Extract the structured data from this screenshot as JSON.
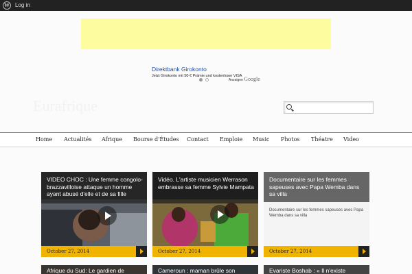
{
  "adminbar": {
    "login_label": "Log in"
  },
  "ad": {
    "title": "Direktbank Girokonto",
    "text": "Jetzt Girokonto mit 50 € Prämie und kostenloser VISA",
    "brand_prefix": "Anzeigen",
    "brand_name": "Google"
  },
  "site": {
    "title": "Eurafrique"
  },
  "search": {
    "value": ""
  },
  "nav": [
    "Home",
    "Actualités",
    "Afrique",
    "Bourse d'Études",
    "Contact",
    "Emploie",
    "Music",
    "Photos",
    "Théatre",
    "Video"
  ],
  "cards": [
    {
      "title": "VIDEO CHOC : Une femme congolo-brazzavilloise attaque un homme ayant abusé d'elle et de sa fille",
      "date": "October 27, 2014"
    },
    {
      "title": "Vidéo. L'artiste musicien Werrason embrasse sa femme Sylvie Mampata",
      "date": "October 27, 2014"
    },
    {
      "title": "Documentaire sur les femmes sapeuses avec Papa Wemba dans sa villa",
      "excerpt": "Documentaire sur les femmes sapeuses avec Papa Wemba dans sa villa",
      "date": "October 27, 2014"
    }
  ],
  "row2": [
    {
      "title": "Afrique du Sud: Le gardien de"
    },
    {
      "title": "Cameroun : maman brûle son"
    },
    {
      "title": "Evariste Boshab : « Il n'existe"
    }
  ],
  "colors": {
    "accent": "#f0b400",
    "card_grey": "#666666",
    "adminbar": "#222222"
  }
}
